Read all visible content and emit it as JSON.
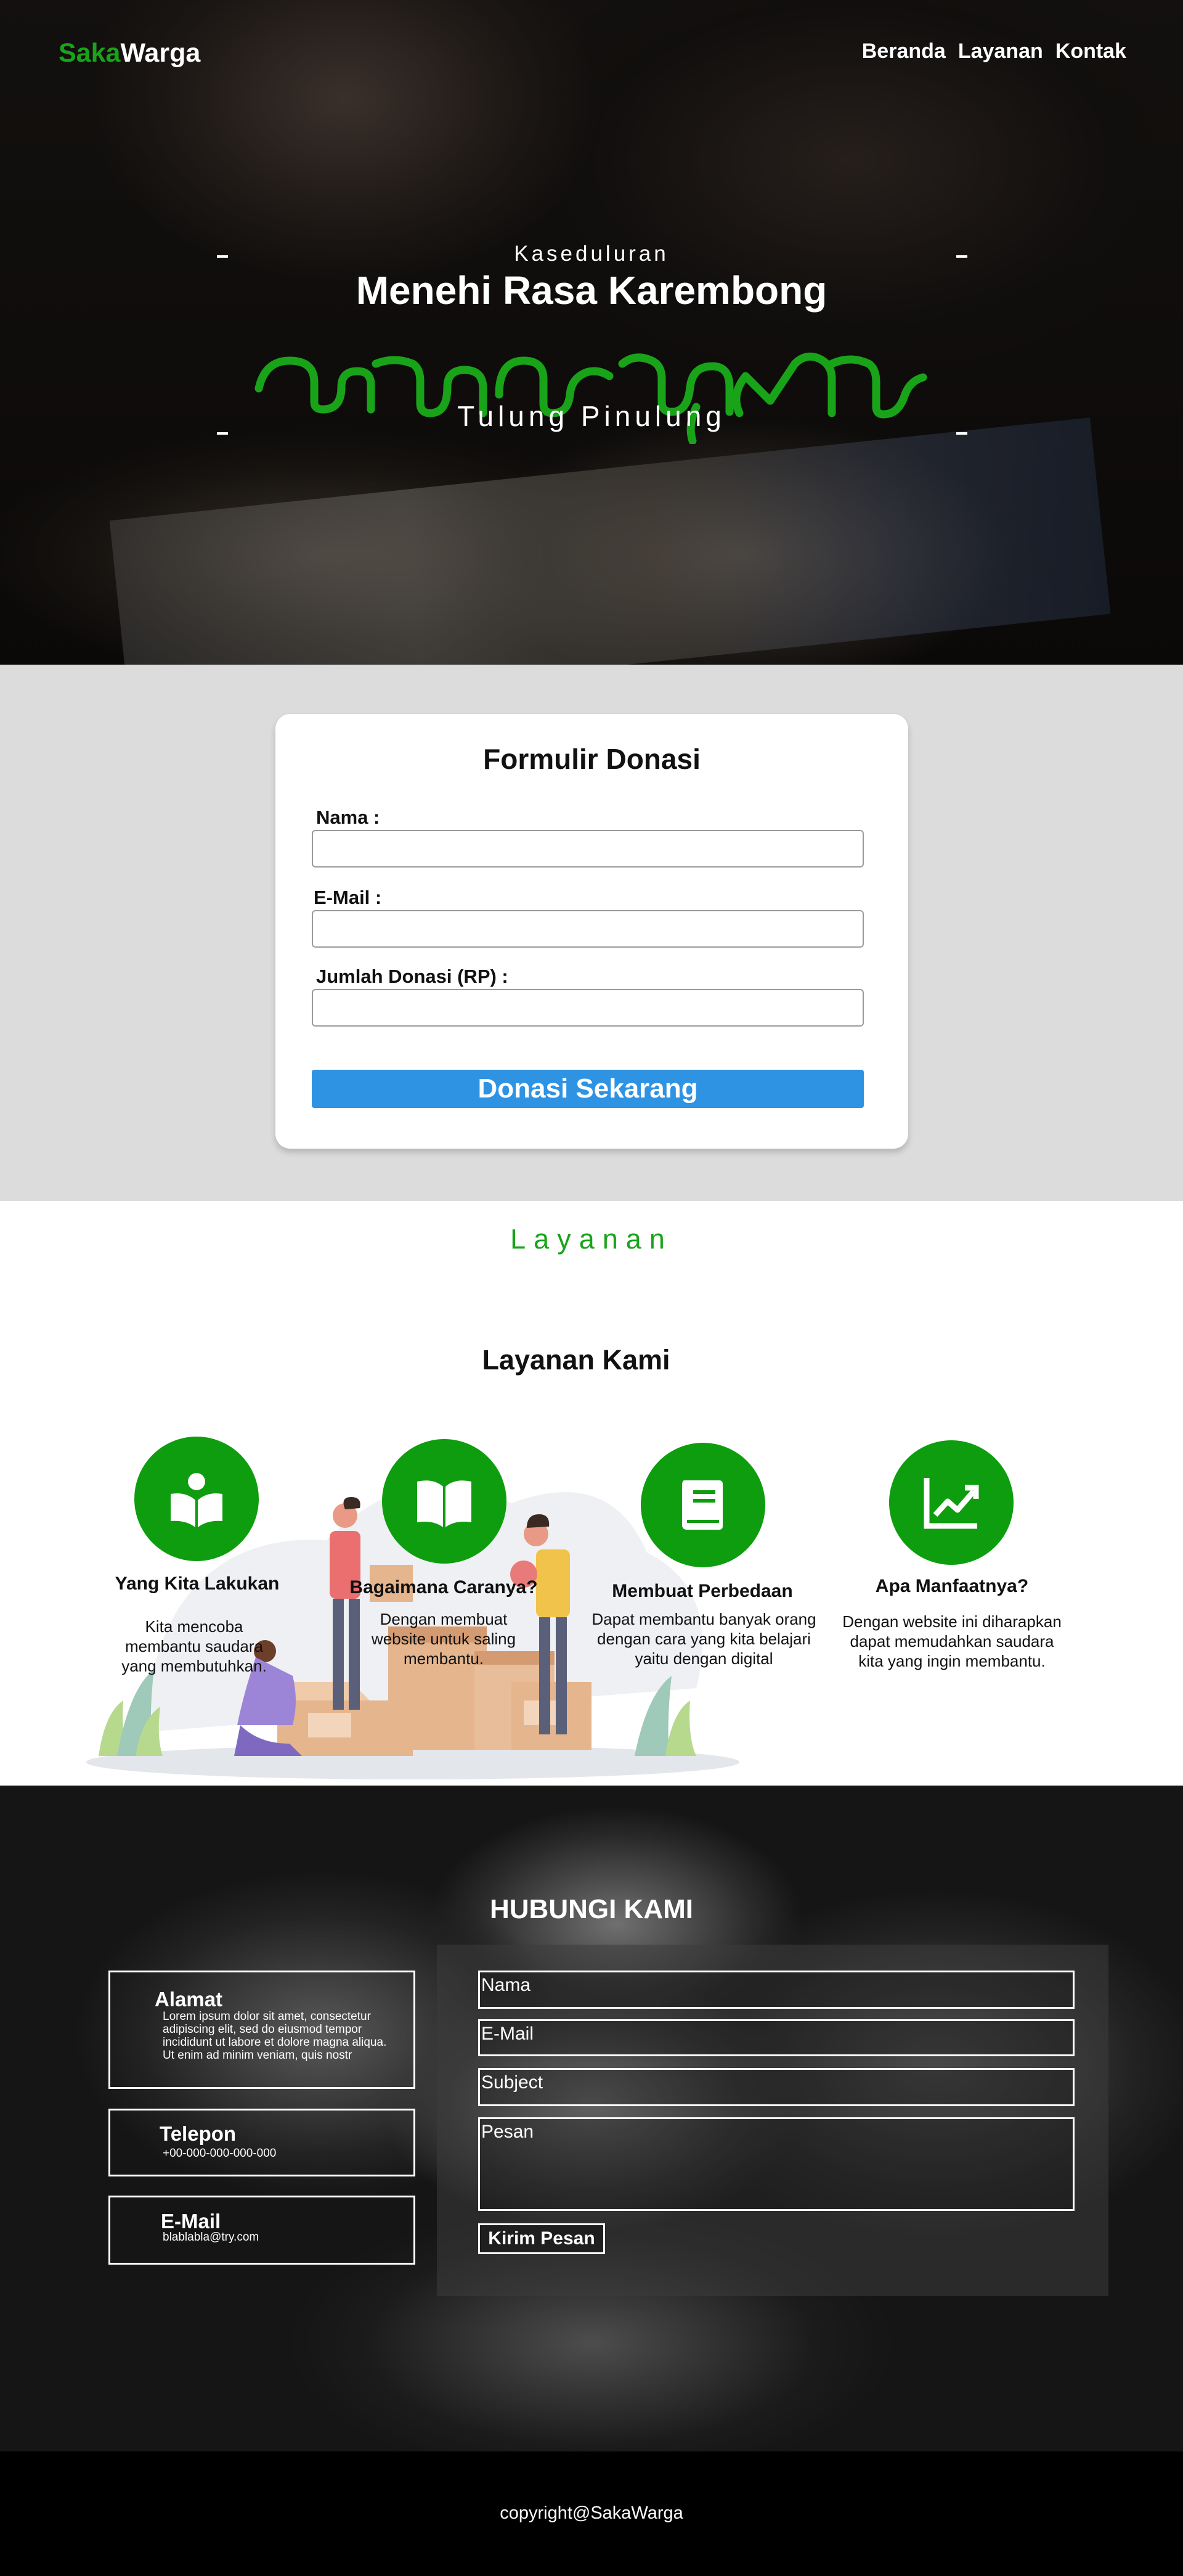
{
  "brand": {
    "part1": "Saka",
    "part2": "Warga"
  },
  "nav": {
    "items": [
      "Beranda",
      "Layanan",
      "Kontak"
    ]
  },
  "hero": {
    "subtitle": "Kaseduluran",
    "title": "Menehi Rasa Karembong",
    "tagline": "Tulung Pinulung",
    "script_color": "#19a319"
  },
  "donation": {
    "title": "Formulir Donasi",
    "fields": [
      {
        "label": "Nama :",
        "value": ""
      },
      {
        "label": "E-Mail :",
        "value": ""
      },
      {
        "label": "Jumlah Donasi (RP) :",
        "value": ""
      }
    ],
    "button_label": "Donasi Sekarang",
    "button_color": "#2f93e4"
  },
  "services": {
    "heading": "Layanan",
    "title": "Layanan Kami",
    "accent": "#0e9d0e",
    "items": [
      {
        "icon": "book-reader-icon",
        "title": "Yang Kita Lakukan",
        "desc": "Kita mencoba membantu saudara yang membutuhkan."
      },
      {
        "icon": "open-book-icon",
        "title": "Bagaimana Caranya?",
        "desc": "Dengan membuat website untuk saling membantu."
      },
      {
        "icon": "closed-book-icon",
        "title": "Membuat Perbedaan",
        "desc": "Dapat membantu banyak orang dengan cara yang kita belajari yaitu dengan digital"
      },
      {
        "icon": "chart-up-icon",
        "title": "Apa Manfaatnya?",
        "desc": "Dengan website ini diharapkan dapat memudahkan saudara kita yang ingin membantu."
      }
    ]
  },
  "contact": {
    "title": "HUBUNGI KAMI",
    "info": [
      {
        "title": "Alamat",
        "text": "Lorem ipsum dolor sit amet, consectetur adipiscing elit, sed do eiusmod tempor incididunt ut labore et dolore magna aliqua. Ut enim ad minim veniam, quis nostr"
      },
      {
        "title": "Telepon",
        "text": "+00-000-000-000-000"
      },
      {
        "title": "E-Mail",
        "text": "blablabla@try.com"
      }
    ],
    "form": {
      "name_placeholder": "Nama",
      "email_placeholder": "E-Mail",
      "subject_placeholder": "Subject",
      "message_placeholder": "Pesan",
      "submit_label": "Kirim Pesan"
    }
  },
  "footer": {
    "copyright": "copyright@SakaWarga"
  }
}
